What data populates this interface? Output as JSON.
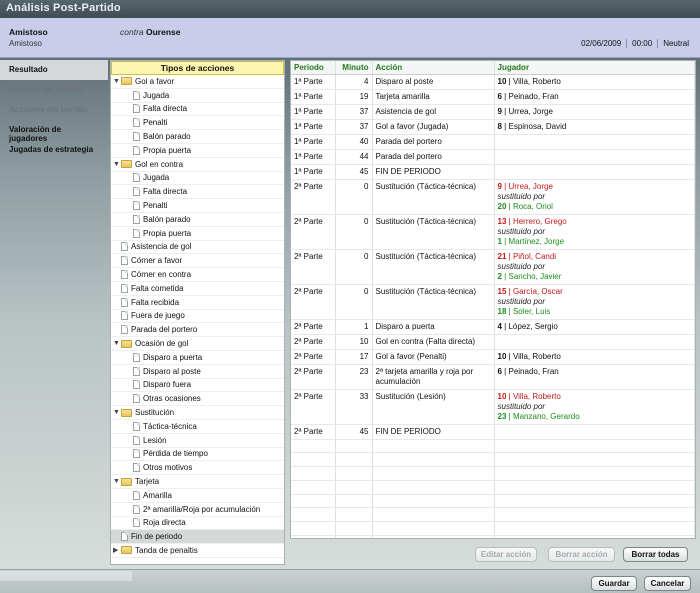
{
  "title": "Análisis Post-Partido",
  "match": {
    "team": "Amistoso",
    "competition": "Amistoso",
    "vs_prefix": "contra",
    "opponent": "Ourense",
    "date": "02/06/2009",
    "time": "00:00",
    "venue": "Neutral"
  },
  "sidebar": {
    "items": [
      {
        "label": "Resultado",
        "state": "active"
      },
      {
        "label": "Análisis del partido",
        "state": "disabled"
      },
      {
        "label": "Acciones del partido",
        "state": "disabled"
      },
      {
        "label": "Valoración de jugadores",
        "state": "normal"
      },
      {
        "label": "Jugadas de estrategia",
        "state": "normal"
      }
    ]
  },
  "tree": {
    "header": "Tipos de acciones",
    "nodes": [
      {
        "label": "Gol a favor",
        "type": "folder",
        "expanded": true,
        "children": [
          "Jugada",
          "Falta directa",
          "Penalti",
          "Balón parado",
          "Propia puerta"
        ]
      },
      {
        "label": "Gol en contra",
        "type": "folder",
        "expanded": true,
        "children": [
          "Jugada",
          "Falta directa",
          "Penalti",
          "Balón parado",
          "Propia puerta"
        ]
      },
      {
        "label": "Asistencia de gol",
        "type": "doc"
      },
      {
        "label": "Córner a favor",
        "type": "doc"
      },
      {
        "label": "Córner en contra",
        "type": "doc"
      },
      {
        "label": "Falta cometida",
        "type": "doc"
      },
      {
        "label": "Falta recibida",
        "type": "doc"
      },
      {
        "label": "Fuera de juego",
        "type": "doc"
      },
      {
        "label": "Parada del portero",
        "type": "doc"
      },
      {
        "label": "Ocasión de gol",
        "type": "folder",
        "expanded": true,
        "children": [
          "Disparo a puerta",
          "Disparo al poste",
          "Disparo fuera",
          "Otras ocasiones"
        ]
      },
      {
        "label": "Sustitución",
        "type": "folder",
        "expanded": true,
        "children": [
          "Táctica-técnica",
          "Lesión",
          "Pérdida de tiempo",
          "Otros motivos"
        ]
      },
      {
        "label": "Tarjeta",
        "type": "folder",
        "expanded": true,
        "children": [
          "Amarilla",
          "2ª amarilla/Roja por acumulación",
          "Roja directa"
        ]
      },
      {
        "label": "Fin de periodo",
        "type": "doc",
        "selected": true
      },
      {
        "label": "Tanda de penaltis",
        "type": "folder",
        "expanded": false,
        "children": []
      }
    ]
  },
  "events": {
    "columns": [
      "Periodo",
      "Minuto",
      "Acción",
      "Jugador"
    ],
    "sub_label": "sustituido por",
    "rows": [
      {
        "period": "1ª Parte",
        "minute": "4",
        "action": "Disparo al poste",
        "player": {
          "num": "10",
          "name": "Villa, Roberto"
        }
      },
      {
        "period": "1ª Parte",
        "minute": "19",
        "action": "Tarjeta amarilla",
        "player": {
          "num": "6",
          "name": "Peinado, Fran"
        }
      },
      {
        "period": "1ª Parte",
        "minute": "37",
        "action": "Asistencia de gol",
        "player": {
          "num": "9",
          "name": "Urrea, Jorge"
        }
      },
      {
        "period": "1ª Parte",
        "minute": "37",
        "action": "Gol a favor (Jugada)",
        "player": {
          "num": "8",
          "name": "Espinosa, David"
        }
      },
      {
        "period": "1ª Parte",
        "minute": "40",
        "action": "Parada del portero"
      },
      {
        "period": "1ª Parte",
        "minute": "44",
        "action": "Parada del portero"
      },
      {
        "period": "1ª Parte",
        "minute": "45",
        "action": "FIN DE PERIODO"
      },
      {
        "period": "2ª Parte",
        "minute": "0",
        "action": "Sustitución (Táctica-técnica)",
        "sub": {
          "out_num": "9",
          "out_name": "Urrea, Jorge",
          "in_num": "20",
          "in_name": "Roca, Oriol"
        }
      },
      {
        "period": "2ª Parte",
        "minute": "0",
        "action": "Sustitución (Táctica-técnica)",
        "sub": {
          "out_num": "13",
          "out_name": "Herrero, Grego",
          "in_num": "1",
          "in_name": "Martínez, Jorge"
        }
      },
      {
        "period": "2ª Parte",
        "minute": "0",
        "action": "Sustitución (Táctica-técnica)",
        "sub": {
          "out_num": "21",
          "out_name": "Piñol, Candi",
          "in_num": "2",
          "in_name": "Sancho, Javier"
        }
      },
      {
        "period": "2ª Parte",
        "minute": "0",
        "action": "Sustitución (Táctica-técnica)",
        "sub": {
          "out_num": "15",
          "out_name": "García, Oscar",
          "in_num": "18",
          "in_name": "Soler, Luis"
        }
      },
      {
        "period": "2ª Parte",
        "minute": "1",
        "action": "Disparo a puerta",
        "player": {
          "num": "4",
          "name": "López, Sergio"
        }
      },
      {
        "period": "2ª Parte",
        "minute": "10",
        "action": "Gol en contra (Falta directa)"
      },
      {
        "period": "2ª Parte",
        "minute": "17",
        "action": "Gol a favor (Penalti)",
        "player": {
          "num": "10",
          "name": "Villa, Roberto"
        }
      },
      {
        "period": "2ª Parte",
        "minute": "23",
        "action": "2ª tarjeta amarilla y roja por acumulación",
        "player": {
          "num": "6",
          "name": "Peinado, Fran"
        }
      },
      {
        "period": "2ª Parte",
        "minute": "33",
        "action": "Sustitución (Lesión)",
        "sub": {
          "out_num": "10",
          "out_name": "Villa, Roberto",
          "in_num": "23",
          "in_name": "Manzano, Gerardo"
        }
      },
      {
        "period": "2ª Parte",
        "minute": "45",
        "action": "FIN DE PERIODO"
      }
    ]
  },
  "buttons": {
    "edit": "Editar acción",
    "delete": "Borrar acción",
    "delete_all": "Borrar todas",
    "save": "Guardar",
    "cancel": "Cancelar"
  },
  "colors": {
    "header_green": "#247a1e",
    "out_red": "#c01818",
    "in_green": "#1d8e1d",
    "match_bar": "#c9cde9",
    "tree_header": "#fdf5ad"
  }
}
